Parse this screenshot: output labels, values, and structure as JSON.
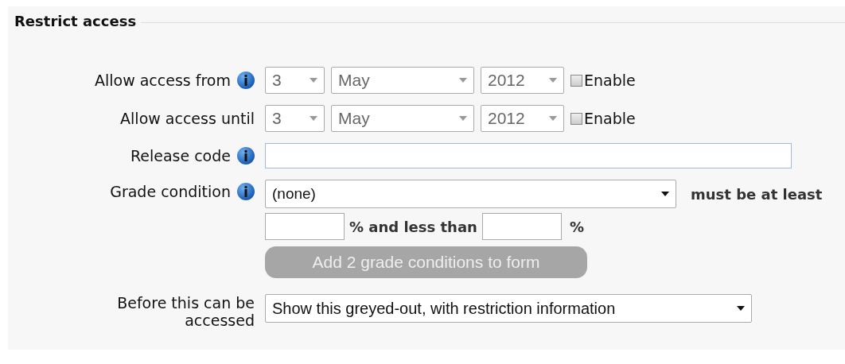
{
  "section": {
    "title": "Restrict access"
  },
  "date_rows": [
    {
      "label": "Allow access from",
      "info": true,
      "day": "3",
      "month": "May",
      "year": "2012",
      "enable_label": "Enable",
      "checked": false
    },
    {
      "label": "Allow access until",
      "info": false,
      "day": "3",
      "month": "May",
      "year": "2012",
      "enable_label": "Enable",
      "checked": false
    }
  ],
  "release_code": {
    "label": "Release code",
    "info": true
  },
  "grade_condition": {
    "label": "Grade condition",
    "info": true,
    "value": "(none)",
    "suffix": "must be at least",
    "between": "% and less than",
    "end": "%"
  },
  "add_button": {
    "label": "Add 2 grade conditions to form",
    "disabled": true
  },
  "before_access": {
    "label_lines": [
      "Before this can be",
      "accessed"
    ],
    "value": "Show this greyed-out, with restriction information"
  }
}
